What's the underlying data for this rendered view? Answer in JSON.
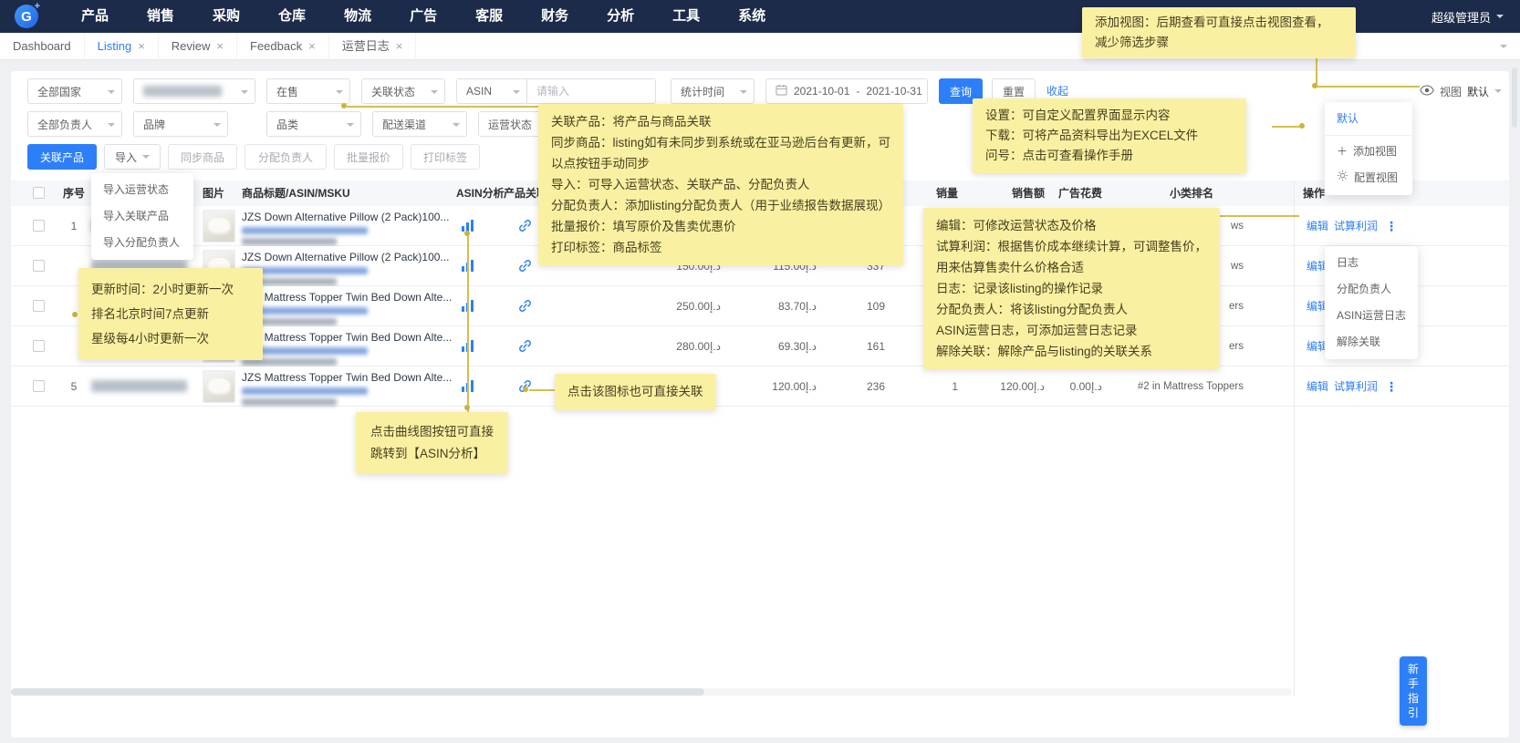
{
  "navbar": {
    "logo": "G",
    "items": [
      "产品",
      "销售",
      "采购",
      "仓库",
      "物流",
      "广告",
      "客服",
      "财务",
      "分析",
      "工具",
      "系统"
    ],
    "user": "超级管理员"
  },
  "tabs": [
    {
      "label": "Dashboard"
    },
    {
      "label": "Listing"
    },
    {
      "label": "Review"
    },
    {
      "label": "Feedback"
    },
    {
      "label": "运营日志"
    }
  ],
  "icons": {
    "close": "×",
    "more": "⋮",
    "add": "＋"
  },
  "filters": {
    "country": "全部国家",
    "status": "在售",
    "relation": "关联状态",
    "search_type": "ASIN",
    "search_placeholder": "请输入",
    "stat_time": "统计时间",
    "date_start": "2021-10-01",
    "date_separator": "-",
    "date_end": "2021-10-31",
    "search_btn": "查询",
    "reset_btn": "重置",
    "collapse": "收起",
    "owner": "全部负责人",
    "brand": "品牌",
    "category": "品类",
    "channel": "配送渠道",
    "op_status": "运营状态",
    "view_label": "视图",
    "view_value": "默认"
  },
  "toolbar": {
    "link_product": "关联产品",
    "import": "导入",
    "sync": "同步商品",
    "assign": "分配负责人",
    "batch_quote": "批量报价",
    "print_label": "打印标签"
  },
  "import_menu": {
    "items": [
      "导入运营状态",
      "导入关联产品",
      "导入分配负责人"
    ]
  },
  "view_menu": {
    "default": "默认",
    "add": "添加视图",
    "config": "配置视图"
  },
  "row_menu": {
    "items": [
      "日志",
      "分配负责人",
      "ASIN运营日志",
      "解除关联"
    ]
  },
  "table": {
    "headers": {
      "seq": "序号",
      "image": "图片",
      "title": "商品标题/ASIN/MSKU",
      "asin_analysis": "ASIN分析",
      "product_link": "产品关联",
      "sales": "销量",
      "revenue": "销售额",
      "ad_cost": "广告花费",
      "rank": "小类排名",
      "ops": "操作"
    },
    "ops": {
      "edit": "编辑",
      "profit": "试算利润"
    },
    "rows": [
      {
        "seq": "1",
        "title": "JZS Down Alternative Pillow (2 Pack)100...",
        "price": "",
        "sale_price": "",
        "reviews": "",
        "sales": "",
        "revenue": "",
        "ad_cost": "",
        "rank": "ws"
      },
      {
        "seq": "",
        "title": "JZS Down Alternative Pillow (2 Pack)100...",
        "price": "150.00د.إ",
        "sale_price": "115.00د.إ",
        "reviews": "337",
        "sales": "",
        "revenue": "",
        "ad_cost": "",
        "rank": "ws"
      },
      {
        "seq": "",
        "title": "JZS Mattress Topper Twin Bed Down Alte...",
        "price": "250.00د.إ",
        "sale_price": "83.70د.إ",
        "reviews": "109",
        "sales": "",
        "revenue": "",
        "ad_cost": "",
        "rank": "ers"
      },
      {
        "seq": "",
        "title": "JZS Mattress Topper Twin Bed Down Alte...",
        "price": "280.00د.إ",
        "sale_price": "69.30د.إ",
        "reviews": "161",
        "sales": "",
        "revenue": "",
        "ad_cost": "",
        "rank": "ers"
      },
      {
        "seq": "5",
        "title": "JZS Mattress Topper Twin Bed Down Alte...",
        "price": "",
        "sale_price": "120.00د.إ",
        "reviews": "236",
        "sales": "1",
        "revenue": "120.00د.إ",
        "ad_cost": "0.00د.إ",
        "rank": "#2 in Mattress Toppers"
      }
    ]
  },
  "notes": {
    "add_view": {
      "lines": [
        "添加视图：后期查看可直接点击视图查看，",
        "减少筛选步骤"
      ]
    },
    "settings": {
      "lines": [
        "设置：可自定义配置界面显示内容",
        "下载：可将产品资料导出为EXCEL文件",
        "问号：点击可查看操作手册"
      ]
    },
    "toolbar_help": {
      "lines": [
        "关联产品：将产品与商品关联",
        "同步商品：listing如有未同步到系统或在亚马逊后台有更新，可",
        "以点按钮手动同步",
        "导入：可导入运营状态、关联产品、分配负责人",
        "分配负责人：添加listing分配负责人（用于业绩报告数据展现）",
        "批量报价：填写原价及售卖优惠价",
        "打印标签：商品标签"
      ]
    },
    "update_time": {
      "lines": [
        "更新时间：2小时更新一次",
        "排名北京时间7点更新",
        "星级每4小时更新一次"
      ]
    },
    "ops_help": {
      "lines": [
        "编辑：可修改运营状态及价格",
        "试算利润：根据售价成本继续计算，可调整售价，",
        "用来估算售卖什么价格合适",
        "日志：记录该listing的操作记录",
        "分配负责人：将该listing分配负责人",
        "ASIN运营日志，可添加运营日志记录",
        "解除关联：解除产品与listing的关联关系"
      ]
    },
    "asin_jump": {
      "lines": [
        "点击曲线图按钮可直接",
        "跳转到【ASIN分析】"
      ]
    },
    "link_icon": {
      "lines": [
        "点击该图标也可直接关联"
      ]
    }
  },
  "guide_btn": "新手指引"
}
